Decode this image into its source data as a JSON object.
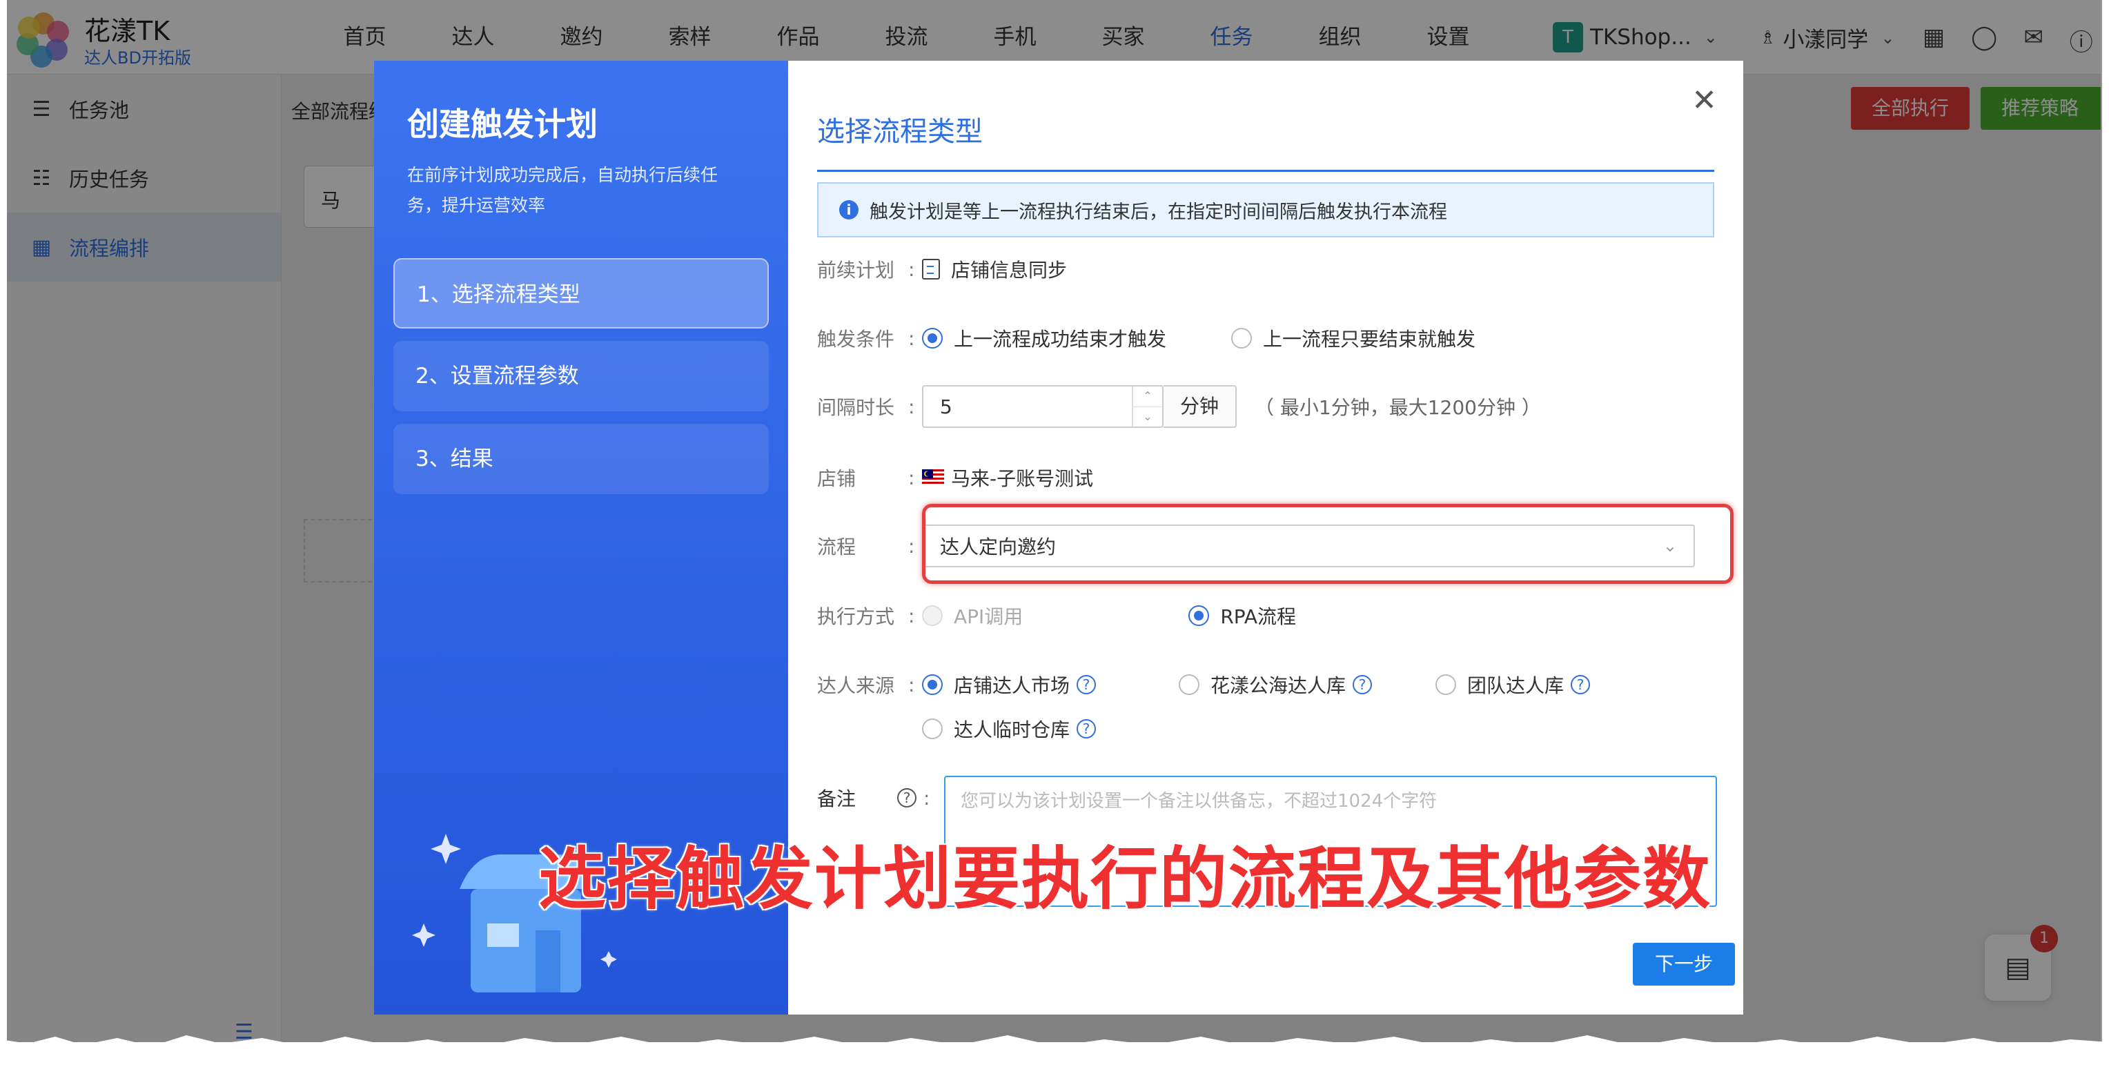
{
  "brand": {
    "name": "花漾TK",
    "subtitle": "达人BD开拓版"
  },
  "nav": {
    "items": [
      "首页",
      "达人",
      "邀约",
      "索样",
      "作品",
      "投流",
      "手机",
      "买家",
      "任务",
      "组织",
      "设置"
    ],
    "active": "任务"
  },
  "header": {
    "shop_name": "TKShop...",
    "shop_badge": "T",
    "user_name": "小漾同学"
  },
  "sidebar": {
    "items": [
      "任务池",
      "历史任务",
      "流程编排"
    ],
    "active": "流程编排"
  },
  "background": {
    "tab_label": "全部流程编",
    "shop_card": "马",
    "exec_all": "全部执行",
    "recommend": "推荐策略",
    "inbox_count": "1"
  },
  "modal": {
    "left": {
      "title": "创建触发计划",
      "desc": "在前序计划成功完成后，自动执行后续任务，提升运营效率",
      "steps": [
        "1、选择流程类型",
        "2、设置流程参数",
        "3、结果"
      ]
    },
    "right": {
      "title": "选择流程类型",
      "info": "触发计划是等上一流程执行结束后，在指定时间间隔后触发执行本流程",
      "prev_plan": {
        "label": "前续计划",
        "value": "店铺信息同步"
      },
      "trigger": {
        "label": "触发条件",
        "option1": "上一流程成功结束才触发",
        "option2": "上一流程只要结束就触发",
        "selected": "上一流程成功结束才触发"
      },
      "interval": {
        "label": "间隔时长",
        "value": "5",
        "unit": "分钟",
        "hint": "（ 最小1分钟，最大1200分钟 ）"
      },
      "shop": {
        "label": "店铺",
        "value": "马来-子账号测试"
      },
      "flow": {
        "label": "流程",
        "value": "达人定向邀约"
      },
      "exec_mode": {
        "label": "执行方式",
        "option1": "API调用",
        "option2": "RPA流程",
        "selected": "RPA流程"
      },
      "source": {
        "label": "达人来源",
        "option1": "店铺达人市场",
        "option2": "花漾公海达人库",
        "option3": "团队达人库",
        "option4": "达人临时仓库",
        "selected": "店铺达人市场"
      },
      "remark": {
        "label": "备注",
        "placeholder": "您可以为该计划设置一个备注以供备忘，不超过1024个字符"
      },
      "next": "下一步"
    }
  },
  "caption": "选择触发计划要执行的流程及其他参数",
  "colors": {
    "primary": "#2f6fe0",
    "highlight": "#e04040",
    "gradient_top": "#3b73f0"
  }
}
